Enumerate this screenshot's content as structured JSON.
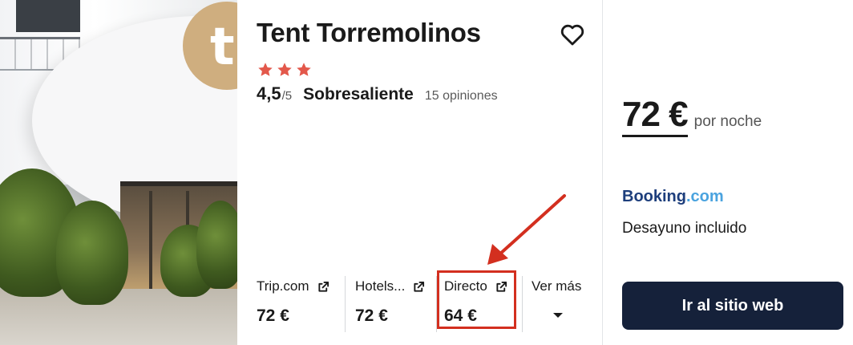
{
  "hotel": {
    "name": "Tent Torremolinos",
    "stars": 3,
    "rating_score": "4,5",
    "rating_outof": "/5",
    "rating_label": "Sobresaliente",
    "reviews": "15 opiniones",
    "photo_logo_letter": "t"
  },
  "providers": [
    {
      "name": "Trip.com",
      "price": "72 €",
      "external": true
    },
    {
      "name": "Hotels...",
      "price": "72 €",
      "external": true
    },
    {
      "name": "Directo",
      "price": "64 €",
      "external": true,
      "highlighted": true
    }
  ],
  "more": {
    "label": "Ver más",
    "icon": "caret-down-icon"
  },
  "offer": {
    "price": "72 €",
    "per_night": "por noche",
    "provider_part1": "Booking",
    "provider_part2": ".com",
    "perk": "Desayuno incluido",
    "cta": "Ir al sitio web"
  },
  "colors": {
    "star": "#e3584b",
    "highlight": "#d32f1f",
    "cta_bg": "#15213a",
    "booking_dark": "#1d3e7c",
    "booking_light": "#4aa3df"
  }
}
